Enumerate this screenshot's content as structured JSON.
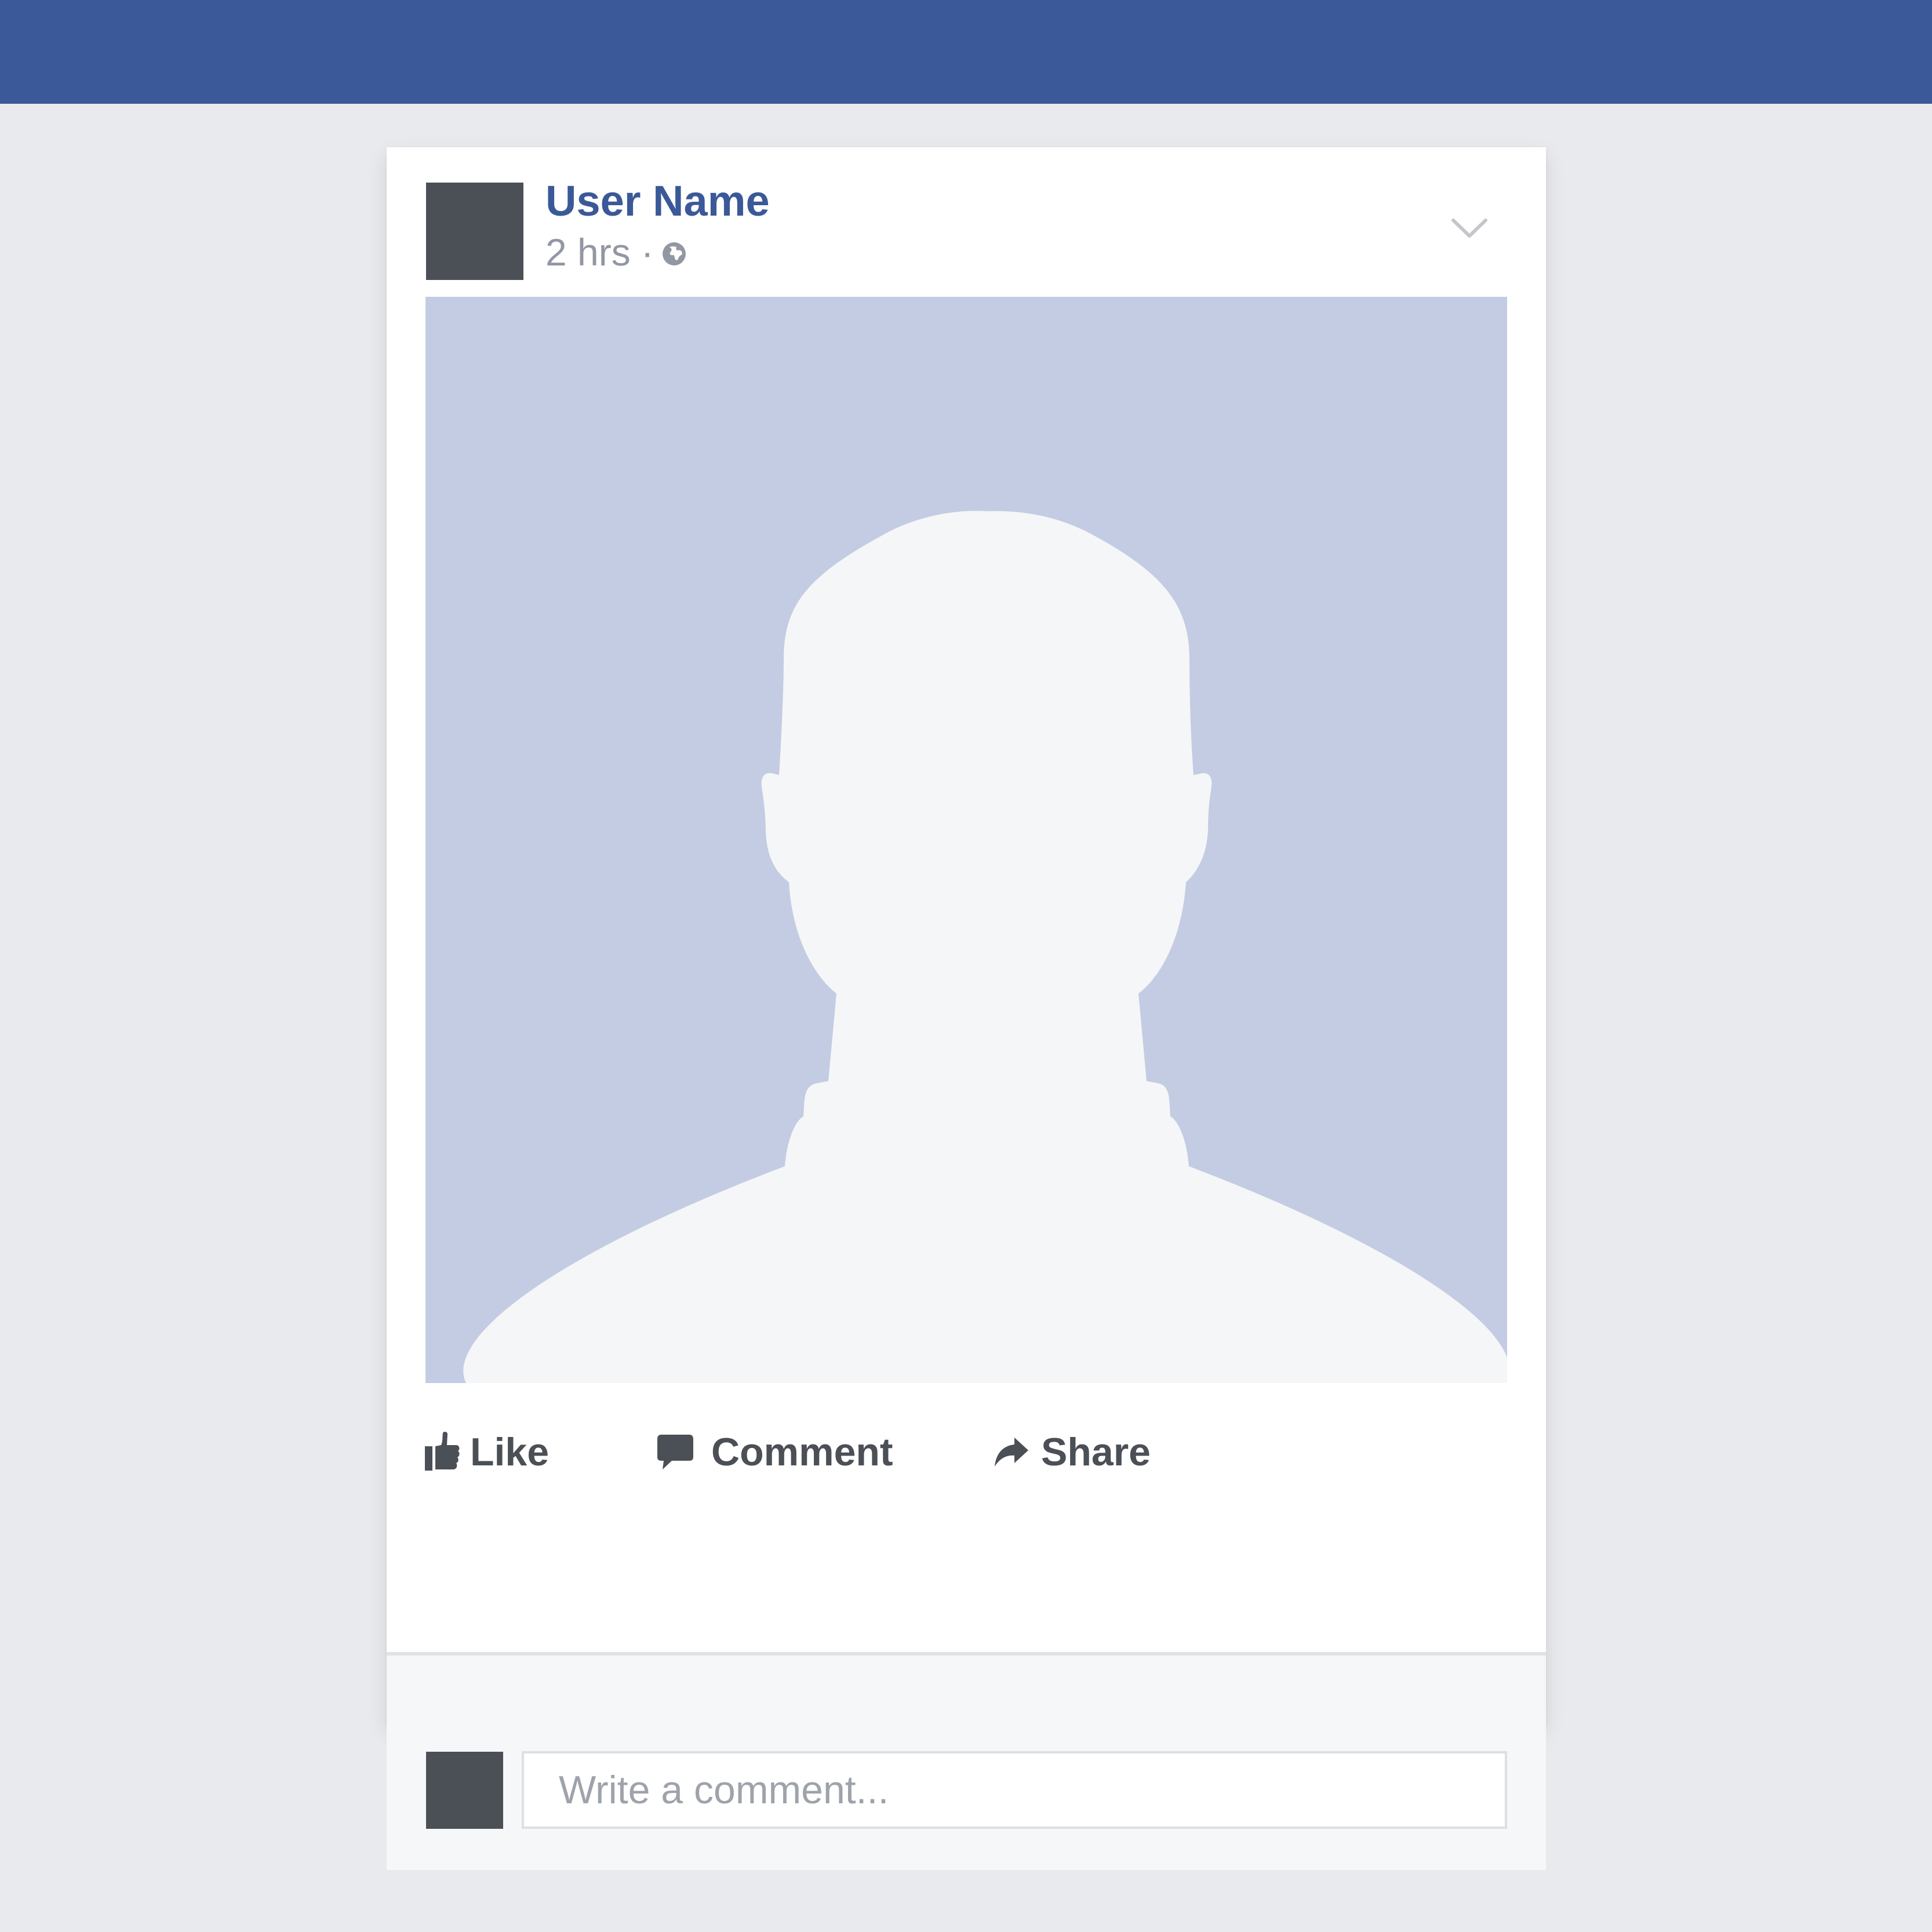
{
  "post": {
    "user_name": "User Name",
    "timestamp": "2 hrs",
    "separator": "·",
    "privacy_icon": "globe-icon",
    "options_icon": "chevron-down-icon",
    "photo_icon": "default-profile-silhouette"
  },
  "actions": {
    "like": {
      "label": "Like",
      "icon": "thumbs-up-icon"
    },
    "comment": {
      "label": "Comment",
      "icon": "speech-bubble-icon"
    },
    "share": {
      "label": "Share",
      "icon": "share-arrow-icon"
    }
  },
  "comment_box": {
    "placeholder": "Write a comment..."
  },
  "colors": {
    "brand": "#3b5998",
    "page_background": "#e9eaed",
    "avatar": "#4b4f56",
    "photo_background": "#c4cce3",
    "silhouette": "#f5f6f8",
    "meta_text": "#9197a3"
  }
}
